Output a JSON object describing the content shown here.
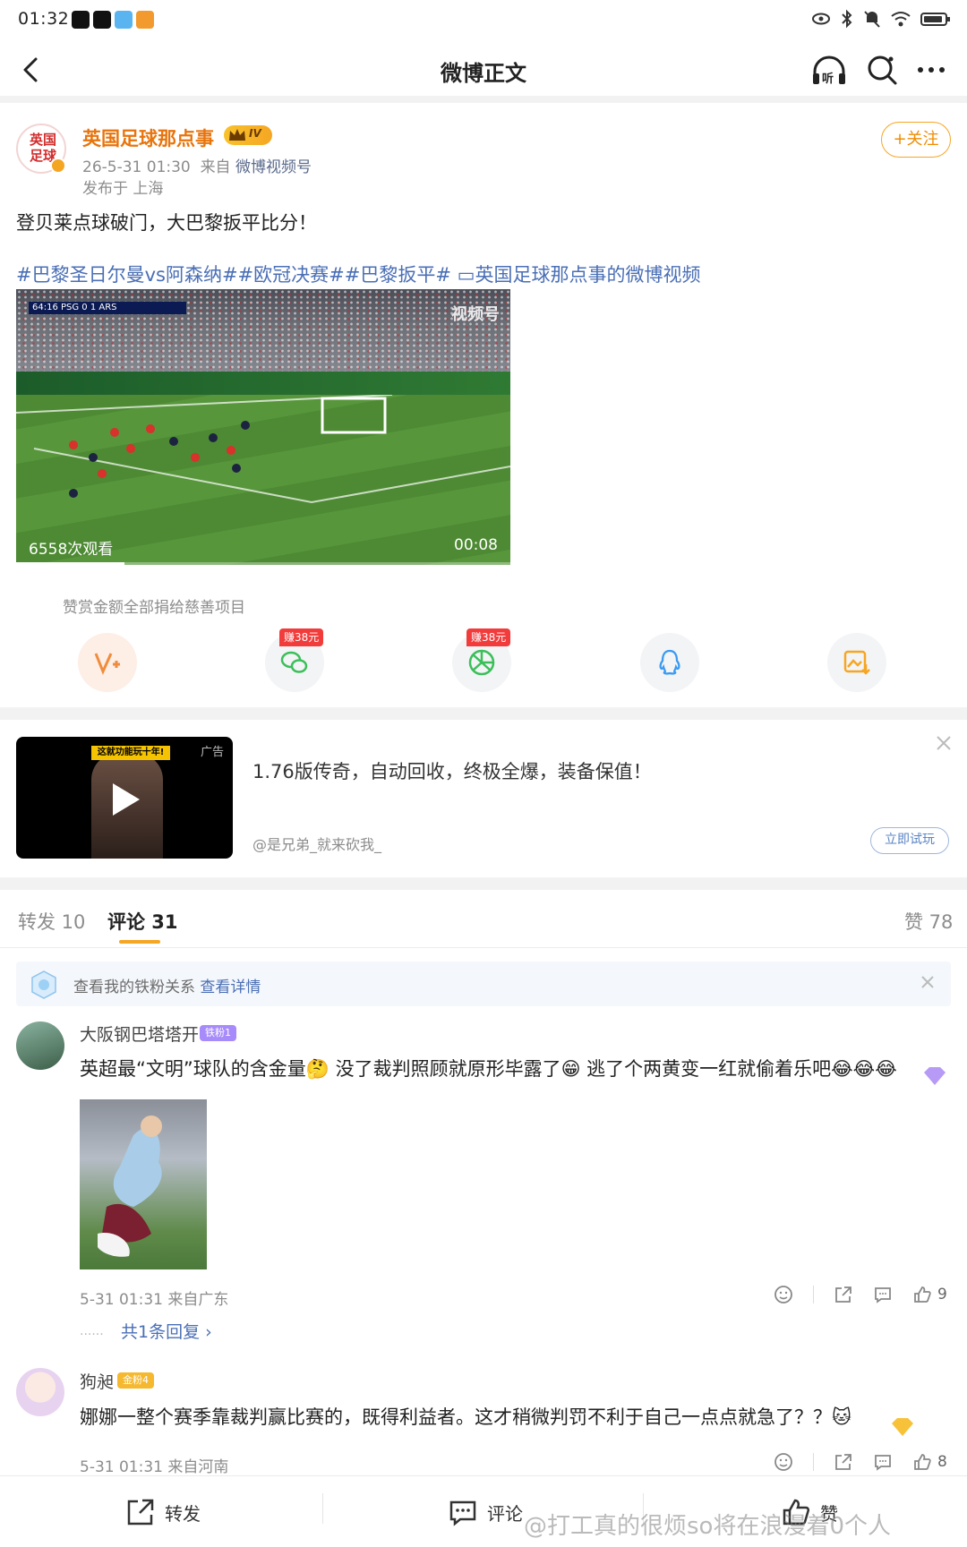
{
  "status_bar": {
    "time": "01:32"
  },
  "nav": {
    "title": "微博正文"
  },
  "post": {
    "avatar_text": "英国足球",
    "author": "英国足球那点事",
    "vip_level": "IV",
    "time": "26-5-31 01:30",
    "source_prefix": "来自",
    "source": "微博视频号",
    "location": "发布于 上海",
    "follow_label": "+关注",
    "text": "登贝莱点球破门，大巴黎扳平比分！",
    "tags": "#巴黎圣日尔曼vs阿森纳##欧冠决赛##巴黎扳平# ",
    "video_link": "英国足球那点事的微博视频",
    "video": {
      "scoreboard": "64:16  PSG  0  1  ARS",
      "brand": "视频号",
      "views": "6558次观看",
      "duration": "00:08",
      "progress": 0.22
    },
    "reward_text": "赞赏金额全部捐给慈善项目",
    "earn_tag_1": "赚38元",
    "earn_tag_2": "赚38元"
  },
  "ad": {
    "thumb_banner": "这就功能玩十年!",
    "label": "广告",
    "text": "1.76版传奇，自动回收，终极全爆，装备保值！",
    "author": "@是兄弟_就来砍我_",
    "cta": "立即试玩"
  },
  "tabs": {
    "repost": "转发 10",
    "comments": "评论 31",
    "likes": "赞 78"
  },
  "fan_banner": {
    "text": "查看我的铁粉关系",
    "link": "查看详情"
  },
  "comments": [
    {
      "name": "大阪钢巴塔塔开",
      "badge": "铁粉1",
      "text": "英超最“文明”球队的含金量🤔 没了裁判照顾就原形毕露了😁 逃了个两黄变一红就偷着乐吧😂😂😂",
      "meta": "5-31 01:31  来自广东",
      "likes": "9",
      "replies": "共1条回复 ›"
    },
    {
      "name": "狗昶",
      "badge": "金粉4",
      "text": "娜娜一整个赛季靠裁判赢比赛的，既得利益者。这才稍微判罚不利于自己一点点就急了？？🐱",
      "meta": "5-31 01:31  来自河南",
      "likes": "8"
    }
  ],
  "bottom_bar": {
    "repost": "转发",
    "comment": "评论",
    "like": "赞"
  },
  "watermark": "@打工真的很烦so将在浪漫着0个人",
  "colors": {
    "accent": "#f5a623",
    "author": "#e8740c",
    "link": "#4a6fb5"
  }
}
